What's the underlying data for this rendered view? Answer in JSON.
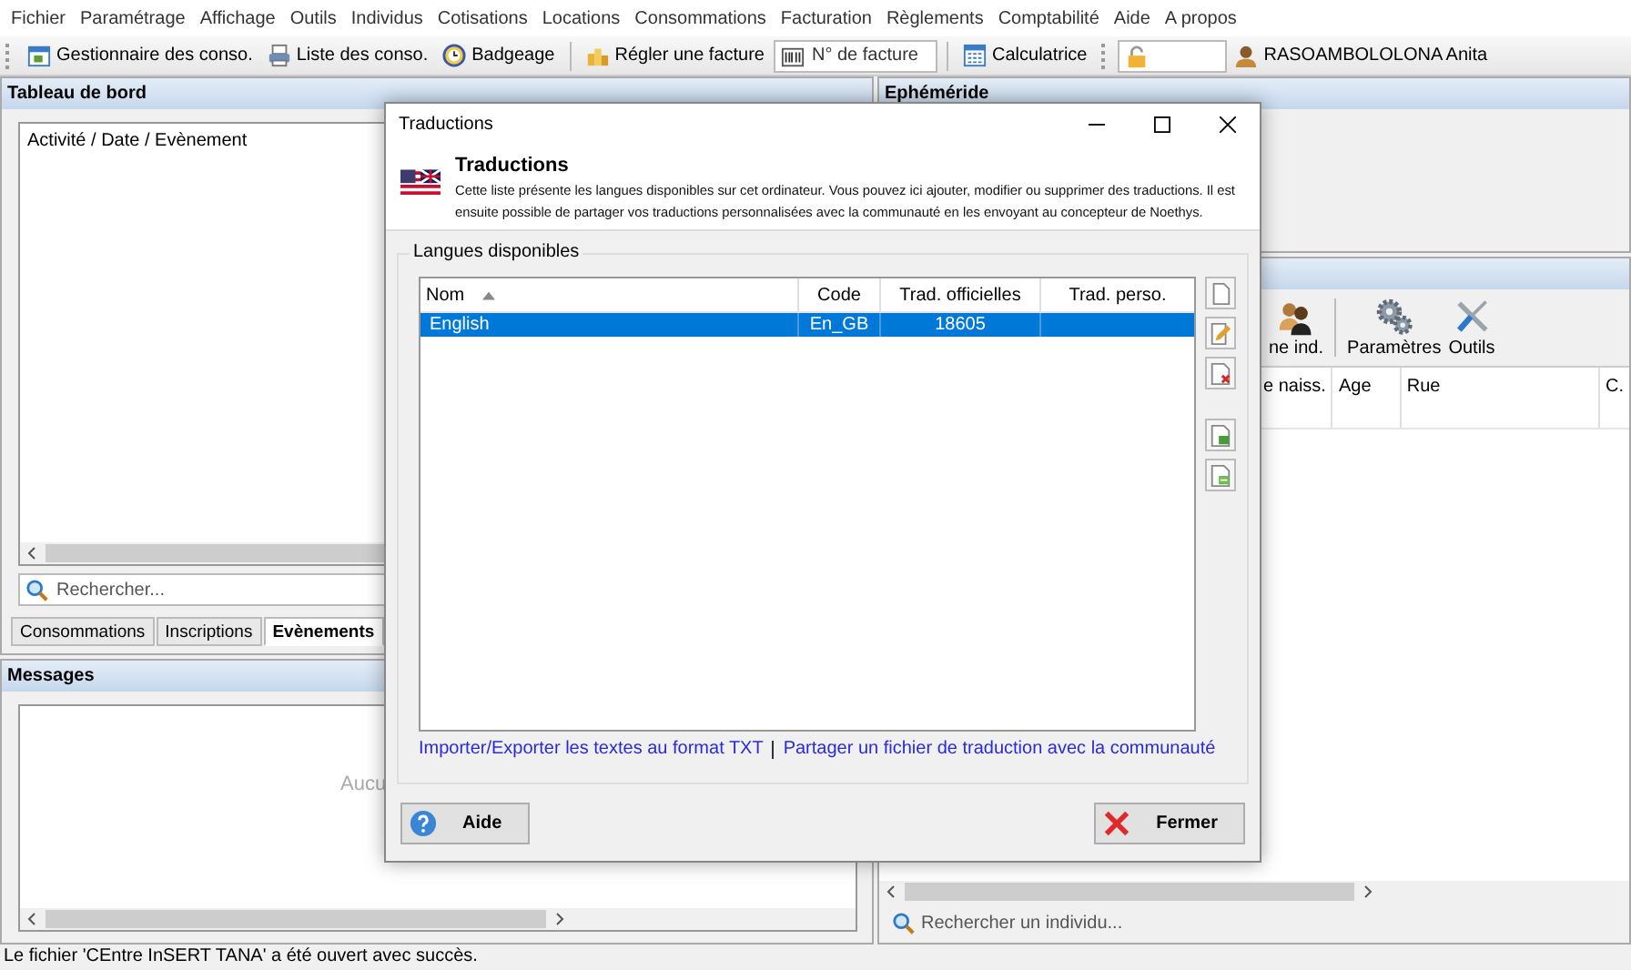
{
  "menu": [
    "Fichier",
    "Paramétrage",
    "Affichage",
    "Outils",
    "Individus",
    "Cotisations",
    "Locations",
    "Consommations",
    "Facturation",
    "Règlements",
    "Comptabilité",
    "Aide",
    "A propos"
  ],
  "toolbar": [
    [
      {
        "kind": "button",
        "label": "Gestionnaire des conso."
      },
      {
        "kind": "button",
        "label": "Liste des conso."
      },
      {
        "kind": "button",
        "label": "Badgeage"
      }
    ],
    [
      {
        "kind": "button",
        "label": "Régler une facture"
      },
      {
        "kind": "field",
        "placeholder": "N° de facture"
      }
    ],
    [
      {
        "kind": "button",
        "label": "Calculatrice"
      }
    ],
    [
      {
        "kind": "password"
      },
      {
        "kind": "user",
        "label": "RASOAMBOLOLONA Anita"
      }
    ]
  ],
  "dashboard": {
    "title": "Tableau de bord",
    "list_header": "Activité / Date / Evènement",
    "search_placeholder": "Rechercher...",
    "tabs": [
      {
        "label": "Consommations",
        "selected": false
      },
      {
        "label": "Inscriptions",
        "selected": false
      },
      {
        "label": "Evènements",
        "selected": true
      }
    ]
  },
  "messages": {
    "title": "Messages",
    "empty_text": "Aucu"
  },
  "ephemeride": {
    "title": "Ephéméride"
  },
  "individuals": {
    "toolbar": [
      "ne ind.",
      "Paramètres",
      "Outils"
    ],
    "columns": [
      "e naiss.",
      "Age",
      "Rue",
      "C."
    ],
    "search_placeholder": "Rechercher un individu..."
  },
  "status_bar": "Le fichier 'CEntre InSERT TANA' a été ouvert avec succès.",
  "dialog": {
    "window_title": "Traductions",
    "title": "Traductions",
    "description": "Cette liste présente les langues disponibles sur cet ordinateur. Vous pouvez ici ajouter, modifier ou supprimer des traductions. Il est ensuite possible de partager vos traductions personnalisées avec la communauté en les envoyant au concepteur de Noethys.",
    "group_label": "Langues disponibles",
    "columns": [
      {
        "label": "Nom",
        "sorted": true
      },
      {
        "label": "Code",
        "sorted": false
      },
      {
        "label": "Trad. officielles",
        "sorted": false
      },
      {
        "label": "Trad. perso.",
        "sorted": false
      }
    ],
    "rows": [
      {
        "name": "English",
        "code": "En_GB",
        "official": "18605",
        "selected": true
      }
    ],
    "links": [
      "Importer/Exporter les textes au format TXT",
      "Partager un fichier de traduction avec la communauté"
    ],
    "buttons": [
      "Aide",
      "Fermer"
    ]
  }
}
